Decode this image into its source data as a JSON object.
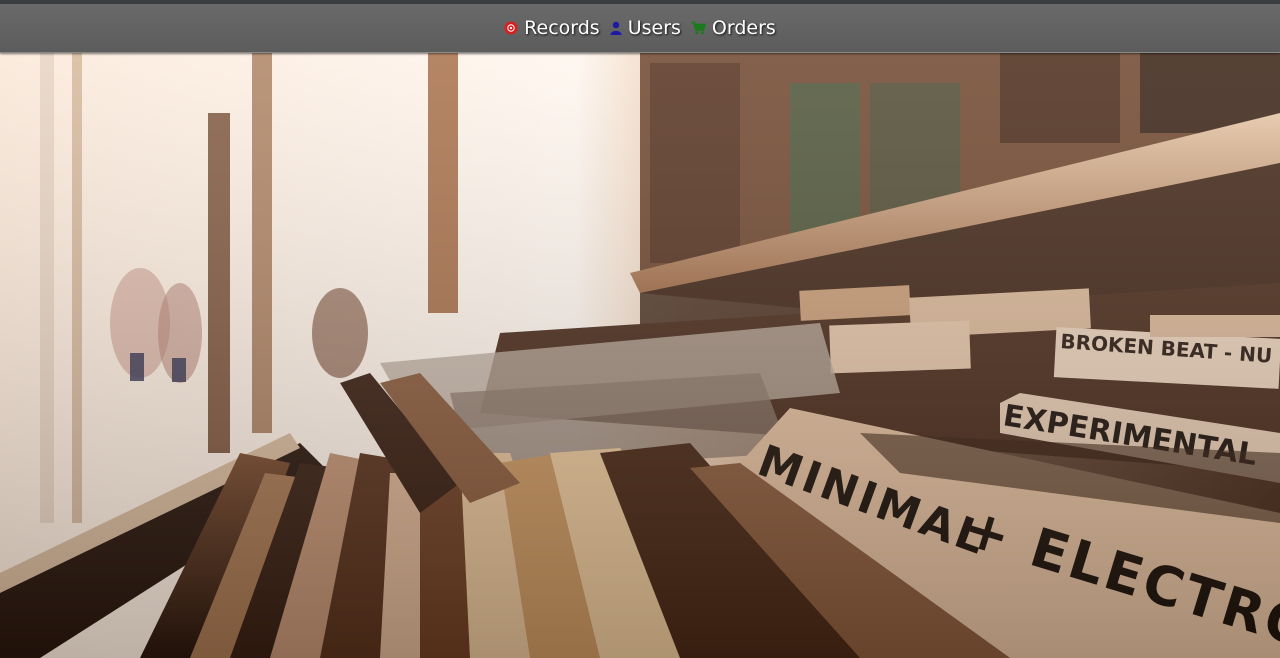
{
  "nav": {
    "items": [
      {
        "label": "Records",
        "icon": "record-icon",
        "color": "#d81e1e"
      },
      {
        "label": "Users",
        "icon": "user-icon",
        "color": "#1a1aa6"
      },
      {
        "label": "Orders",
        "icon": "cart-icon",
        "color": "#1c7a1c"
      }
    ]
  },
  "hero": {
    "image": "record-store-bins-photo",
    "divider_labels": [
      "MINIMAL + ELECTRO",
      "EXPERIMENTAL",
      "BROKEN BEAT - NU"
    ]
  },
  "colors": {
    "navbar": "#616161",
    "top_strip": "#3c3d40",
    "photo_tint": "#8a5a3a"
  }
}
